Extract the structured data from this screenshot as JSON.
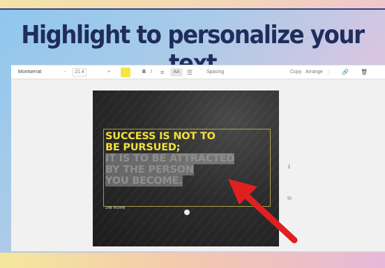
{
  "headline": "Highlight to personalize your text",
  "toolbar": {
    "font_name": "Montserrat",
    "font_size_minus": "-",
    "font_size": "21.4",
    "font_size_plus": "+",
    "text_color": "#f5e642",
    "bold_label": "B",
    "italic_label": "I",
    "align_icon": "≡",
    "case_label": "AA",
    "list_icon": "☰",
    "spacing_label": "Spacing",
    "copy_label": "Copy",
    "arrange_label": "Arrange",
    "position_icon": "⫶",
    "link_icon": "🔗",
    "trash_icon": "🗑"
  },
  "design": {
    "quote_lines": [
      "SUCCESS IS NOT TO",
      "BE PURSUED;",
      "IT IS TO BE ATTRACTED",
      "BY THE PERSON",
      "YOU BECOME."
    ],
    "byline": "JIM ROHN"
  },
  "colors": {
    "headline": "#1f2d5c",
    "quote_yellow": "#f2e13a",
    "quote_gray": "#8f8f8f",
    "arrow": "#e02020"
  }
}
